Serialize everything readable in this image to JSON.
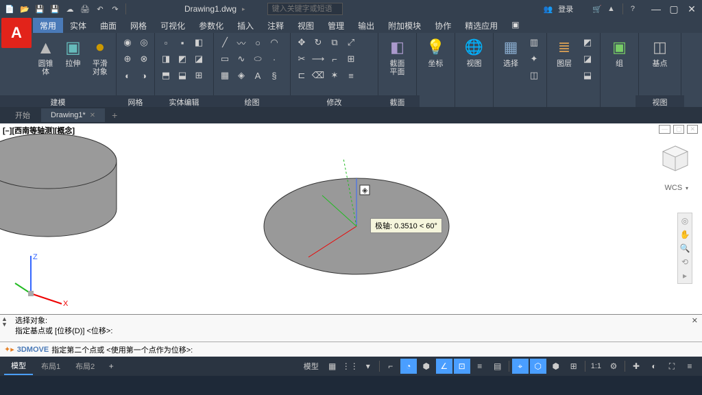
{
  "qat": {
    "title": "Drawing1.dwg",
    "search_ph": "键入关键字或短语",
    "login": "登录"
  },
  "tabs": [
    "常用",
    "实体",
    "曲面",
    "网格",
    "可视化",
    "参数化",
    "插入",
    "注释",
    "视图",
    "管理",
    "输出",
    "附加模块",
    "协作",
    "精选应用"
  ],
  "panels": {
    "p1": {
      "title": "建模",
      "b1": "圆锥体",
      "b2": "拉伸",
      "b3a": "平滑",
      "b3b": "对象"
    },
    "p2": {
      "title": "网格"
    },
    "p3": {
      "title": "实体编辑"
    },
    "p4": {
      "title": "绘图"
    },
    "p5": {
      "title": "修改"
    },
    "p6": {
      "title": "截面",
      "btn": "截面\n平面"
    },
    "p7": {
      "btn": "坐标"
    },
    "p8": {
      "title": "",
      "btn": "视图"
    },
    "p9": {
      "btn": "选择"
    },
    "p10": {
      "btn": "图层"
    },
    "p11": {
      "btn": "组"
    },
    "p12": {
      "title": "视图",
      "btn": "基点"
    }
  },
  "doc_tabs": {
    "t1": "开始",
    "t2": "Drawing1*"
  },
  "viewport": {
    "label": "[–][西南等轴测][概念]",
    "tooltip": "极轴: 0.3510 < 60°",
    "wcs": "WCS"
  },
  "cmd": {
    "l1": "选择对象:",
    "l2": "指定基点或 [位移(D)] <位移>:",
    "name": "3DMOVE",
    "prompt": "指定第二个点或 <使用第一个点作为位移>:"
  },
  "status": {
    "t1": "模型",
    "t2": "布局1",
    "t3": "布局2",
    "model_btn": "模型",
    "zoom": "1:1"
  }
}
